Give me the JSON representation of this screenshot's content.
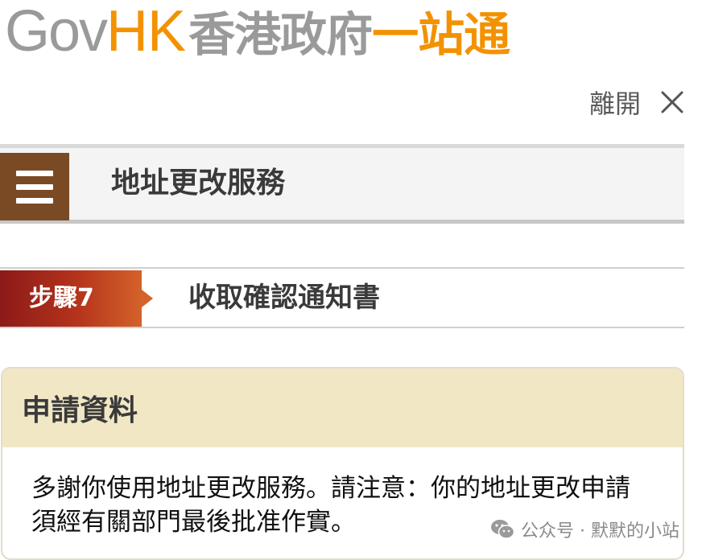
{
  "logo": {
    "gov": "Gov",
    "hk": "HK",
    "zh_main": "香港政府",
    "zh_accent": "一站通"
  },
  "header": {
    "leave_label": "離開",
    "close_icon": "close-icon"
  },
  "service": {
    "menu_icon": "hamburger-menu-icon",
    "title": "地址更改服務"
  },
  "step": {
    "label": "步驟7",
    "title": "收取確認通知書"
  },
  "panel": {
    "title": "申請資料",
    "message": "多謝你使用地址更改服務。請注意：你的地址更改申請須經有關部門最後批准作實。"
  },
  "watermark": {
    "text": "公众号 · 默默的小站",
    "icon": "wechat-icon"
  },
  "colors": {
    "brand_orange": "#f39200",
    "logo_grey": "#9a9a9a",
    "menu_brown": "#7a4a24",
    "step_red": "#8c1a1a",
    "panel_header_bg": "#f1e7c5"
  }
}
